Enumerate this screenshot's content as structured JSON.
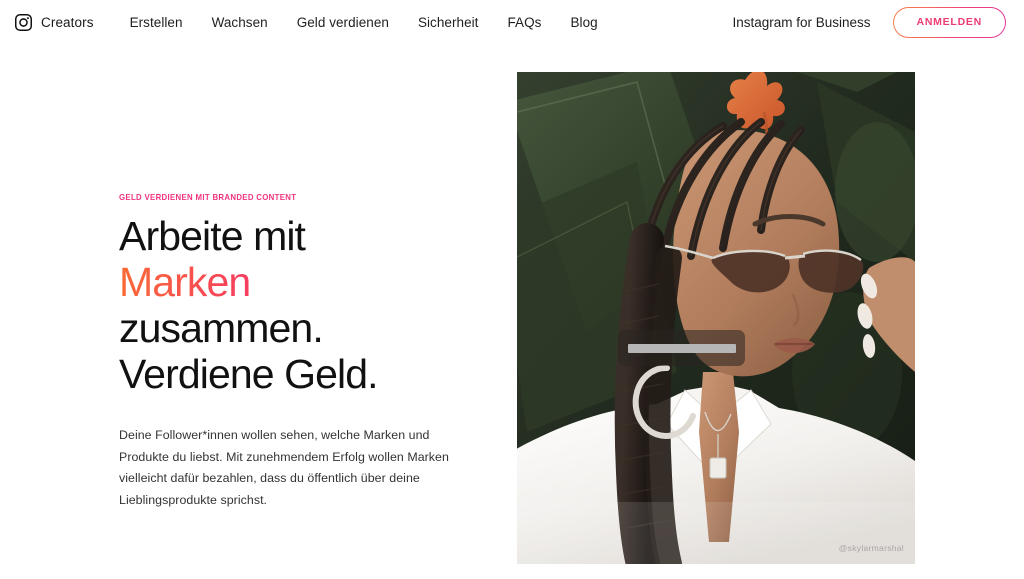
{
  "header": {
    "brand": {
      "icon": "instagram-camera-icon",
      "label": "Creators"
    },
    "nav_items": [
      {
        "label": "Erstellen"
      },
      {
        "label": "Wachsen"
      },
      {
        "label": "Geld verdienen"
      },
      {
        "label": "Sicherheit"
      },
      {
        "label": "FAQs"
      },
      {
        "label": "Blog"
      }
    ],
    "business_link": "Instagram for Business",
    "signup_button": "ANMELDEN"
  },
  "hero": {
    "eyebrow": "GELD VERDIENEN MIT BRANDED CONTENT",
    "headline_line1": "Arbeite mit",
    "headline_accent": "Marken",
    "headline_line3": "zusammen.",
    "headline_line4": "Verdiene Geld.",
    "body": "Deine Follower*innen wollen sehen, welche Marken und Produkte du liebst. Mit zunehmendem Erfolg wollen Marken vielleicht dafür bezahlen, dass du öffentlich über deine Lieblingsprodukte sprichst.",
    "media": {
      "watermark": "@skylarmarshal",
      "alt": "Portrait einer Frau mit geflochtenen Zöpfen, Sonnenbrille und weißem Hemd vor tropischen Blättern"
    }
  },
  "colors": {
    "accent_pink": "#f1347f",
    "gradient_start": "#fa6b34",
    "gradient_end": "#e31f96",
    "text_primary": "#111111",
    "text_body": "#333333",
    "background": "#ffffff"
  }
}
